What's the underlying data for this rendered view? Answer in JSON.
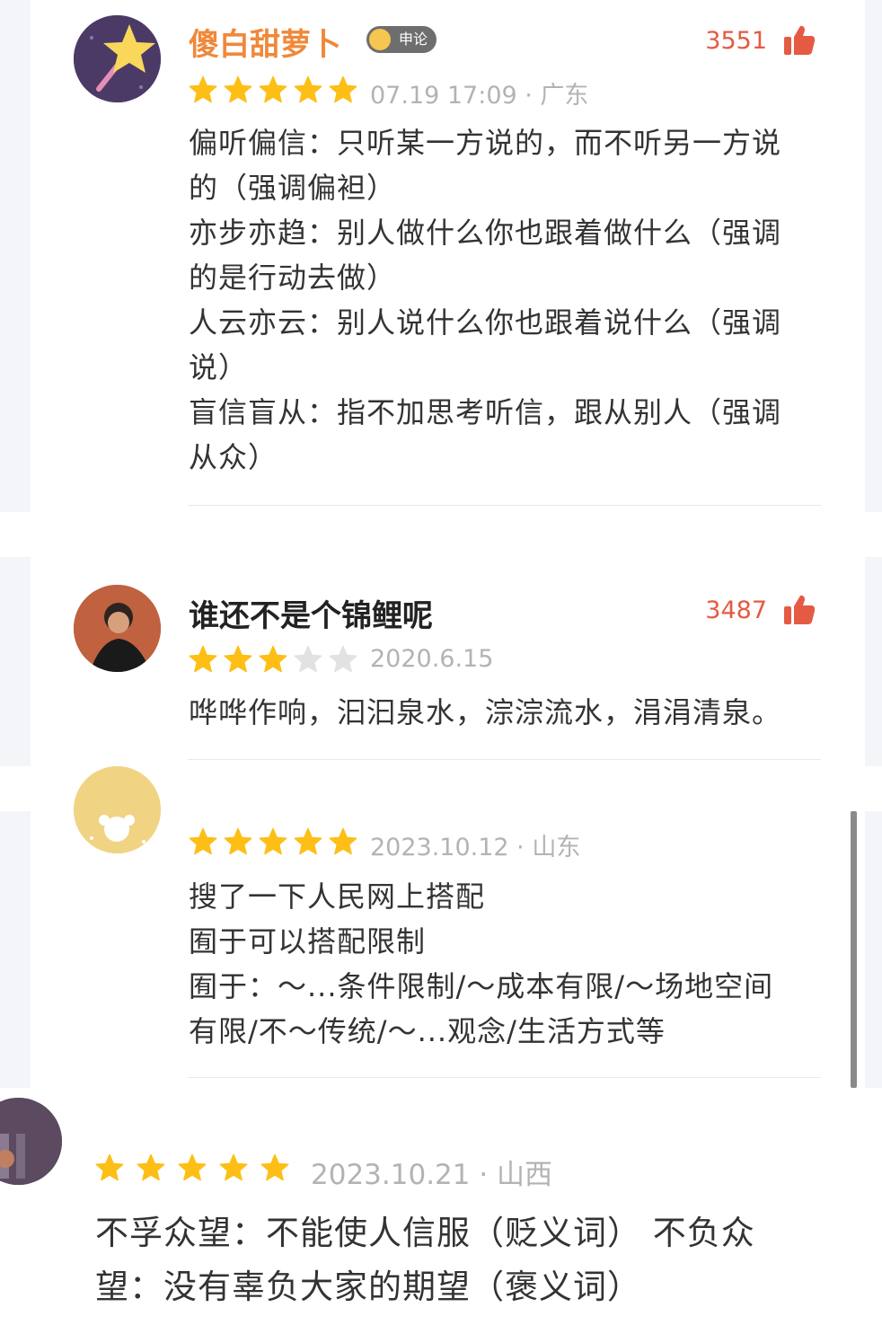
{
  "comments": [
    {
      "username": "傻白甜萝卜",
      "badge": "申论",
      "likes": "3551",
      "rating": 5,
      "meta": "07.19  17:09 · 广东",
      "lines": [
        "偏听偏信：只听某一方说的，而不听另一方说",
        "的（强调偏袒）",
        "亦步亦趋：别人做什么你也跟着做什么（强调",
        "的是行动去做）",
        "人云亦云：别人说什么你也跟着说什么（强调",
        "说）",
        "盲信盲从：指不加思考听信，跟从别人（强调",
        "从众）"
      ]
    },
    {
      "username": "谁还不是个锦鲤呢",
      "likes": "3487",
      "rating": 3,
      "meta": "2020.6.15",
      "lines": [
        "哗哗作响，汩汩泉水，淙淙流水，涓涓清泉。"
      ]
    },
    {
      "rating": 5,
      "meta": "2023.10.12 · 山东",
      "lines": [
        "搜了一下人民网上搭配",
        " 囿于可以搭配限制",
        "囿于：～...条件限制/～成本有限/～场地空间",
        "有限/不～传统/～...观念/生活方式等"
      ]
    },
    {
      "rating": 5,
      "meta": "2023.10.21 · 山西",
      "lines": [
        "不孚众望：不能使人信服（贬义词） 不负众",
        "望：没有辜负大家的期望（褒义词）"
      ]
    }
  ],
  "colors": {
    "username_highlight": "#f0883a",
    "username_default": "#222222",
    "like": "#e55a43",
    "star_on": "#fdbf16",
    "star_off": "#e2e2e2",
    "text": "#333333",
    "meta": "#b3b3b3"
  },
  "icons": {
    "like": "thumbs-up-icon",
    "star": "star-icon",
    "badge": "vip-badge-icon"
  }
}
